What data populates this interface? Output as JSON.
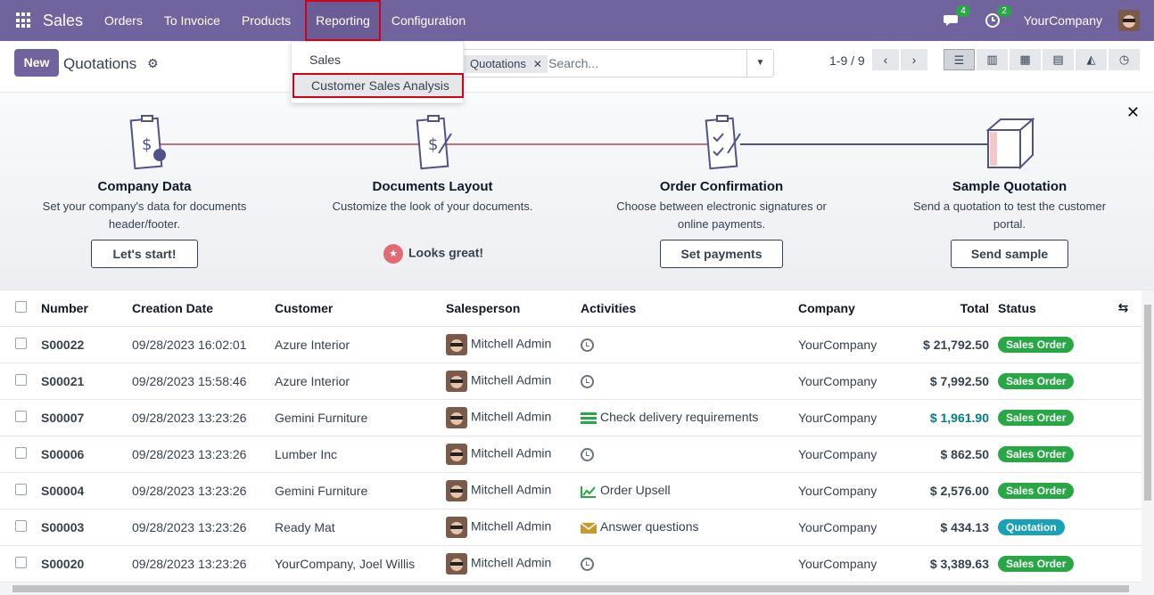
{
  "topbar": {
    "brand": "Sales",
    "menu": [
      "Orders",
      "To Invoice",
      "Products",
      "Reporting",
      "Configuration"
    ],
    "active_menu": "Reporting",
    "messages_count": "4",
    "activities_count": "2",
    "company": "YourCompany"
  },
  "control": {
    "new_label": "New",
    "title": "Quotations",
    "facet": "Quotations",
    "search_placeholder": "Search...",
    "pager": "1-9 / 9"
  },
  "reporting_dropdown": {
    "items": [
      "Sales",
      "Customer Sales Analysis"
    ]
  },
  "onboarding": {
    "steps": [
      {
        "title": "Company Data",
        "desc": "Set your company's data for documents header/footer.",
        "button": "Let's start!"
      },
      {
        "title": "Documents Layout",
        "desc": "Customize the look of your documents.",
        "done": "Looks great!"
      },
      {
        "title": "Order Confirmation",
        "desc": "Choose between electronic signatures or online payments.",
        "button": "Set payments"
      },
      {
        "title": "Sample Quotation",
        "desc": "Send a quotation to test the customer portal.",
        "button": "Send sample"
      }
    ]
  },
  "table": {
    "columns": [
      "Number",
      "Creation Date",
      "Customer",
      "Salesperson",
      "Activities",
      "Company",
      "Total",
      "Status"
    ],
    "rows": [
      {
        "number": "S00022",
        "date": "09/28/2023 16:02:01",
        "customer": "Azure Interior",
        "salesperson": "Mitchell Admin",
        "activity": "",
        "activity_icon": "clock-icon",
        "company": "YourCompany",
        "total": "$ 21,792.50",
        "status": "Sales Order"
      },
      {
        "number": "S00021",
        "date": "09/28/2023 15:58:46",
        "customer": "Azure Interior",
        "salesperson": "Mitchell Admin",
        "activity": "",
        "activity_icon": "clock-icon",
        "company": "YourCompany",
        "total": "$ 7,992.50",
        "status": "Sales Order"
      },
      {
        "number": "S00007",
        "date": "09/28/2023 13:23:26",
        "customer": "Gemini Furniture",
        "salesperson": "Mitchell Admin",
        "activity": "Check delivery requirements",
        "activity_icon": "tasks-icon",
        "company": "YourCompany",
        "total": "$ 1,961.90",
        "status": "Sales Order"
      },
      {
        "number": "S00006",
        "date": "09/28/2023 13:23:26",
        "customer": "Lumber Inc",
        "salesperson": "Mitchell Admin",
        "activity": "",
        "activity_icon": "clock-icon",
        "company": "YourCompany",
        "total": "$ 862.50",
        "status": "Sales Order"
      },
      {
        "number": "S00004",
        "date": "09/28/2023 13:23:26",
        "customer": "Gemini Furniture",
        "salesperson": "Mitchell Admin",
        "activity": "Order Upsell",
        "activity_icon": "line-chart-icon",
        "company": "YourCompany",
        "total": "$ 2,576.00",
        "status": "Sales Order"
      },
      {
        "number": "S00003",
        "date": "09/28/2023 13:23:26",
        "customer": "Ready Mat",
        "salesperson": "Mitchell Admin",
        "activity": "Answer questions",
        "activity_icon": "envelope-icon",
        "company": "YourCompany",
        "total": "$ 434.13",
        "status": "Quotation"
      },
      {
        "number": "S00020",
        "date": "09/28/2023 13:23:26",
        "customer": "YourCompany, Joel Willis",
        "salesperson": "Mitchell Admin",
        "activity": "",
        "activity_icon": "clock-icon",
        "company": "YourCompany",
        "total": "$ 3,389.63",
        "status": "Sales Order"
      }
    ]
  },
  "colors": {
    "brand": "#71639e",
    "sales_order": "#28a745",
    "quotation": "#17a2b8",
    "highlight_total": "#017e84"
  }
}
